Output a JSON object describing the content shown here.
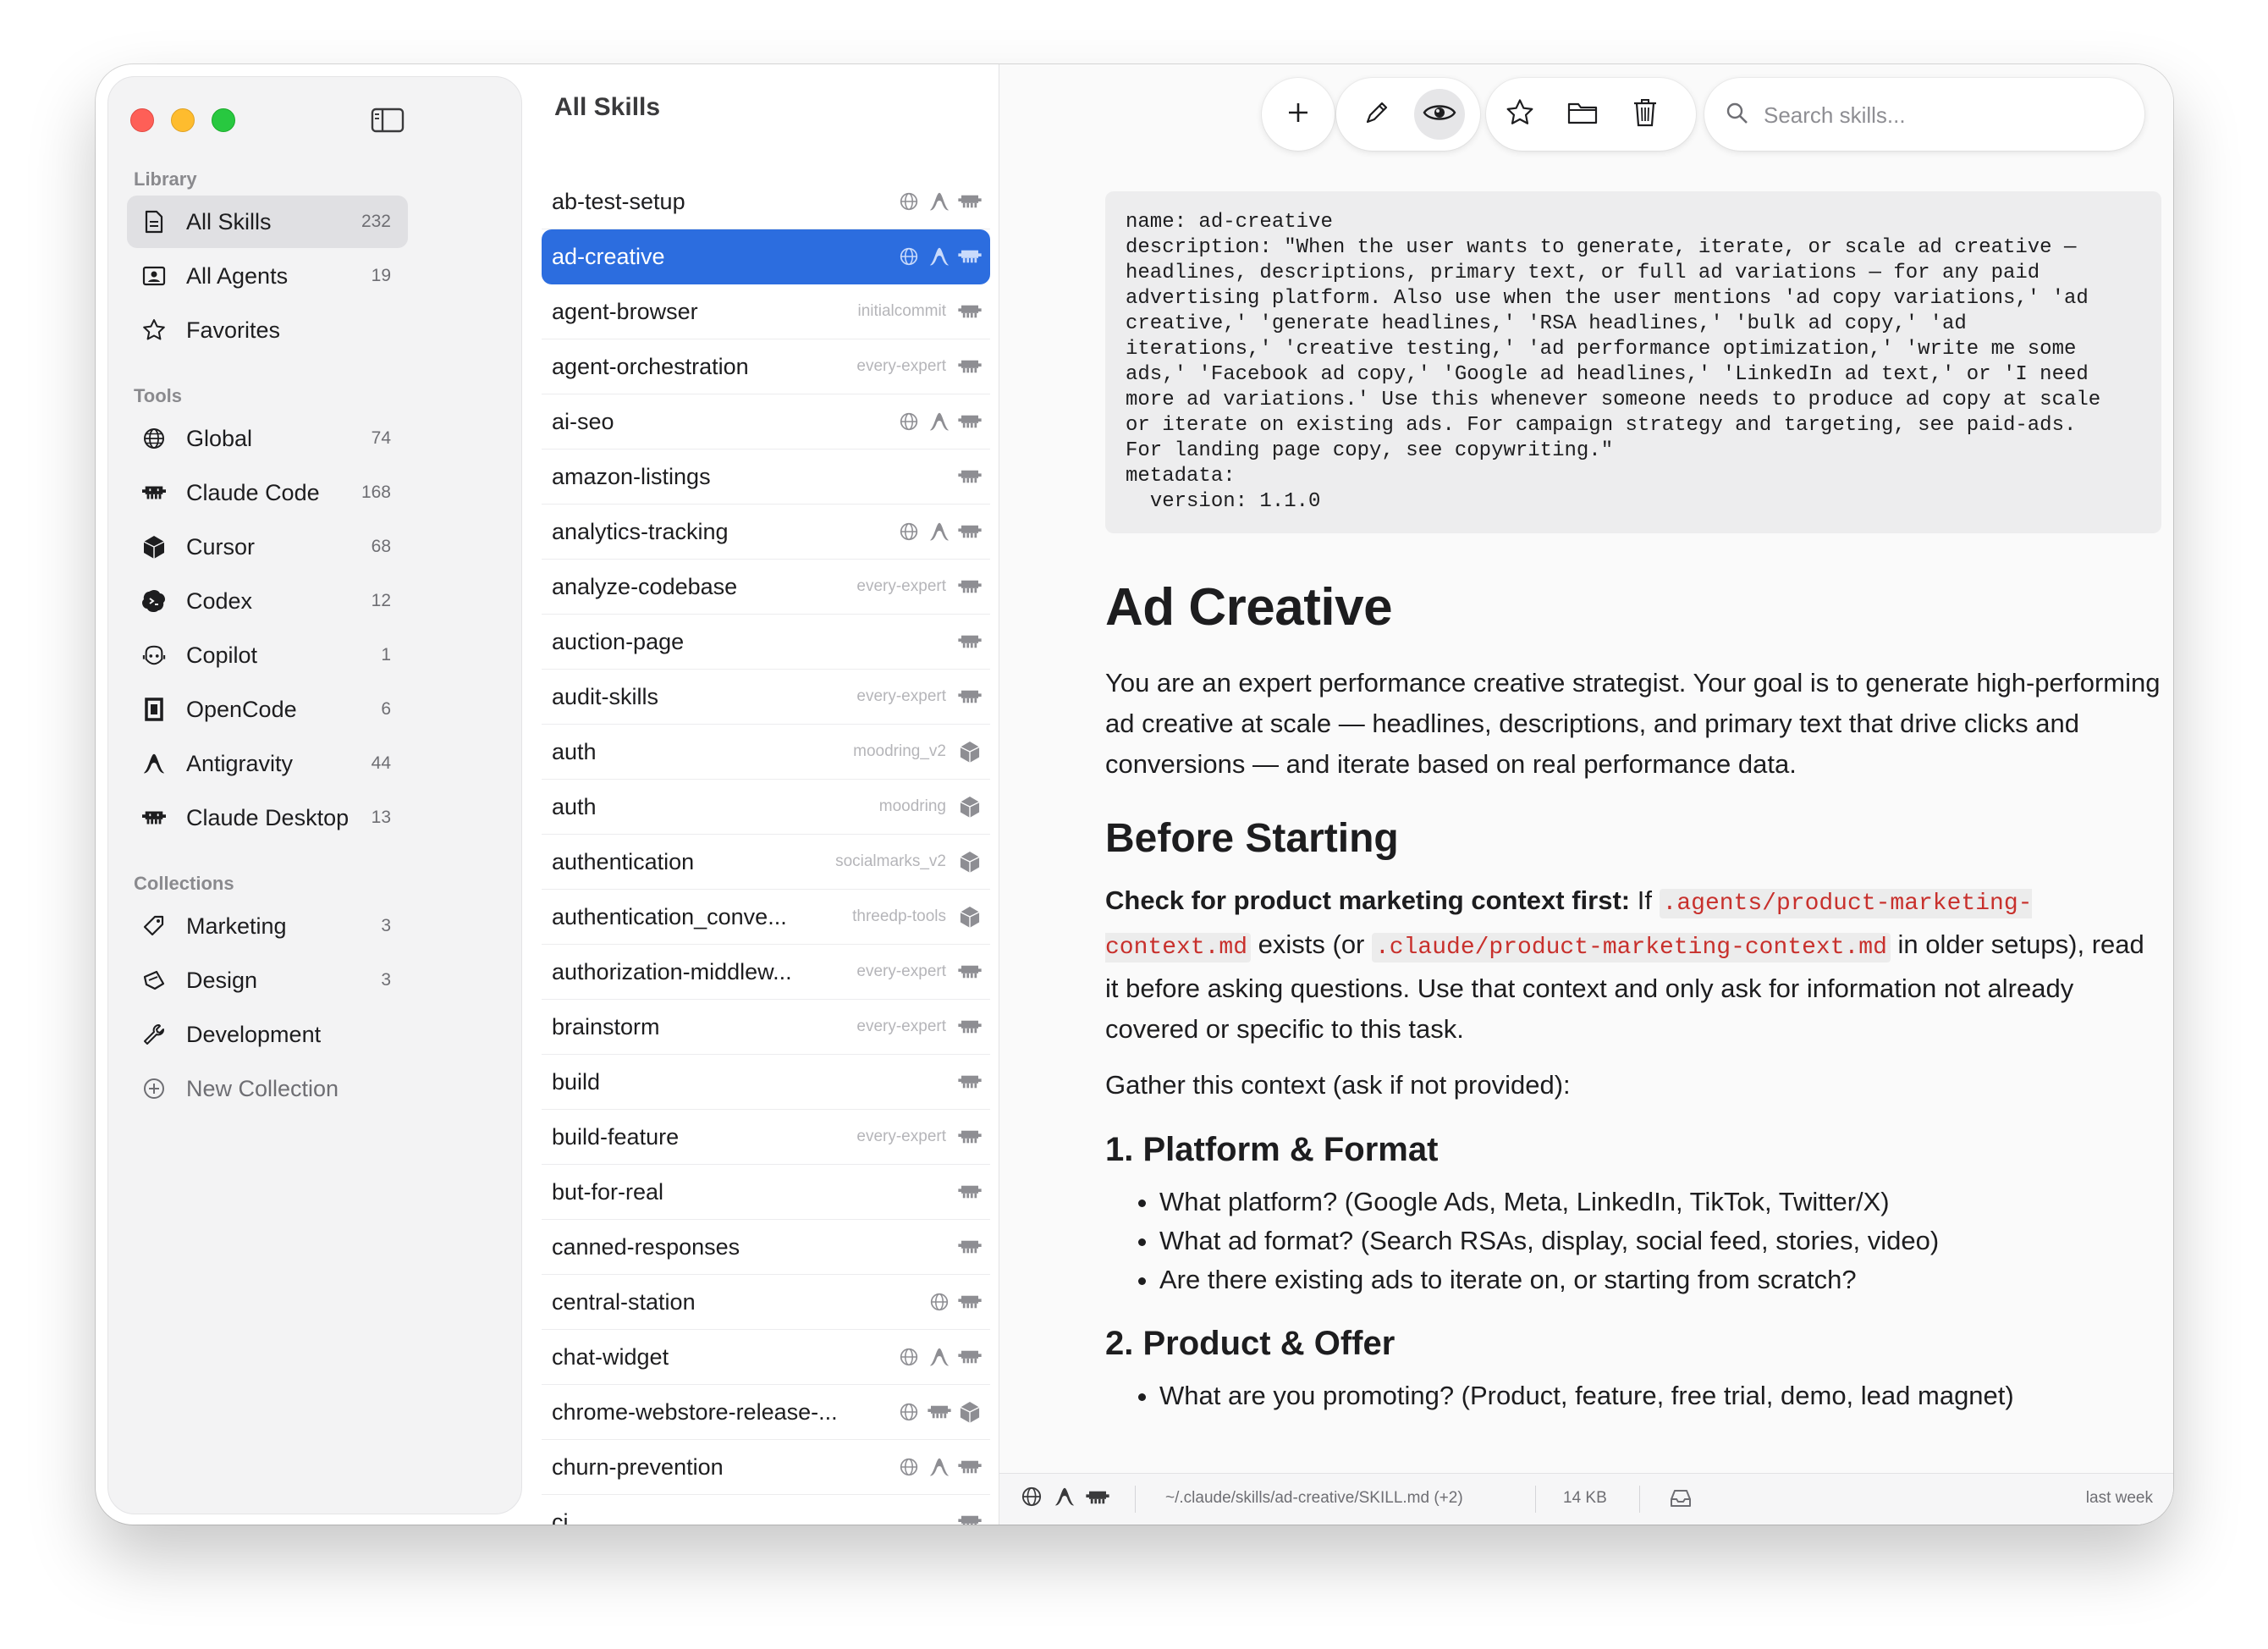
{
  "sidebar": {
    "library_title": "Library",
    "tools_title": "Tools",
    "collections_title": "Collections",
    "library": [
      {
        "label": "All Skills",
        "count": "232",
        "icon": "document-icon"
      },
      {
        "label": "All Agents",
        "count": "19",
        "icon": "person-card-icon"
      },
      {
        "label": "Favorites",
        "count": "",
        "icon": "star-icon"
      }
    ],
    "tools": [
      {
        "label": "Global",
        "count": "74",
        "icon": "globe-icon"
      },
      {
        "label": "Claude Code",
        "count": "168",
        "icon": "claude-code-icon"
      },
      {
        "label": "Cursor",
        "count": "68",
        "icon": "cursor-cube-icon"
      },
      {
        "label": "Codex",
        "count": "12",
        "icon": "codex-icon"
      },
      {
        "label": "Copilot",
        "count": "1",
        "icon": "copilot-icon"
      },
      {
        "label": "OpenCode",
        "count": "6",
        "icon": "opencode-icon"
      },
      {
        "label": "Antigravity",
        "count": "44",
        "icon": "antigravity-icon"
      },
      {
        "label": "Claude Desktop",
        "count": "13",
        "icon": "claude-desktop-icon"
      }
    ],
    "collections": [
      {
        "label": "Marketing",
        "count": "3",
        "icon": "tag-icon"
      },
      {
        "label": "Design",
        "count": "3",
        "icon": "palette-icon"
      },
      {
        "label": "Development",
        "count": "",
        "icon": "wrench-icon"
      }
    ],
    "new_collection": "New Collection"
  },
  "list": {
    "title": "All Skills",
    "rows": [
      {
        "name": "ab-test-setup",
        "org": "",
        "tags": [
          "globe",
          "antigravity",
          "claude"
        ]
      },
      {
        "name": "ad-creative",
        "org": "",
        "tags": [
          "globe",
          "antigravity",
          "claude"
        ],
        "selected": true
      },
      {
        "name": "agent-browser",
        "org": "initialcommit",
        "tags": [
          "claude"
        ]
      },
      {
        "name": "agent-orchestration",
        "org": "every-expert",
        "tags": [
          "claude"
        ]
      },
      {
        "name": "ai-seo",
        "org": "",
        "tags": [
          "globe",
          "antigravity",
          "claude"
        ]
      },
      {
        "name": "amazon-listings",
        "org": "",
        "tags": [
          "claude"
        ]
      },
      {
        "name": "analytics-tracking",
        "org": "",
        "tags": [
          "globe",
          "antigravity",
          "claude"
        ]
      },
      {
        "name": "analyze-codebase",
        "org": "every-expert",
        "tags": [
          "claude"
        ]
      },
      {
        "name": "auction-page",
        "org": "",
        "tags": [
          "claude"
        ]
      },
      {
        "name": "audit-skills",
        "org": "every-expert",
        "tags": [
          "claude"
        ]
      },
      {
        "name": "auth",
        "org": "moodring_v2",
        "tags": [
          "cursor"
        ]
      },
      {
        "name": "auth",
        "org": "moodring",
        "tags": [
          "cursor"
        ]
      },
      {
        "name": "authentication",
        "org": "socialmarks_v2",
        "tags": [
          "cursor"
        ]
      },
      {
        "name": "authentication_conve...",
        "org": "threedp-tools",
        "tags": [
          "cursor"
        ]
      },
      {
        "name": "authorization-middlew...",
        "org": "every-expert",
        "tags": [
          "claude"
        ]
      },
      {
        "name": "brainstorm",
        "org": "every-expert",
        "tags": [
          "claude"
        ]
      },
      {
        "name": "build",
        "org": "",
        "tags": [
          "claude"
        ]
      },
      {
        "name": "build-feature",
        "org": "every-expert",
        "tags": [
          "claude"
        ]
      },
      {
        "name": "but-for-real",
        "org": "",
        "tags": [
          "claude"
        ]
      },
      {
        "name": "canned-responses",
        "org": "",
        "tags": [
          "claude"
        ]
      },
      {
        "name": "central-station",
        "org": "",
        "tags": [
          "globe",
          "claude"
        ]
      },
      {
        "name": "chat-widget",
        "org": "",
        "tags": [
          "globe",
          "antigravity",
          "claude"
        ]
      },
      {
        "name": "chrome-webstore-release-...",
        "org": "",
        "tags": [
          "globe",
          "claude",
          "cursor"
        ]
      },
      {
        "name": "churn-prevention",
        "org": "",
        "tags": [
          "globe",
          "antigravity",
          "claude"
        ]
      },
      {
        "name": "ci",
        "org": "",
        "tags": [
          "claude"
        ]
      }
    ]
  },
  "toolbar": {
    "add": "add-icon",
    "edit": "pencil-icon",
    "preview": "eye-icon",
    "favorite": "star-icon",
    "folder": "folder-icon",
    "delete": "trash-icon"
  },
  "search": {
    "placeholder": "Search skills...",
    "value": ""
  },
  "doc": {
    "frontmatter": "name: ad-creative\ndescription: \"When the user wants to generate, iterate, or scale ad creative —\nheadlines, descriptions, primary text, or full ad variations — for any paid\nadvertising platform. Also use when the user mentions 'ad copy variations,' 'ad\ncreative,' 'generate headlines,' 'RSA headlines,' 'bulk ad copy,' 'ad\niterations,' 'creative testing,' 'ad performance optimization,' 'write me some\nads,' 'Facebook ad copy,' 'Google ad headlines,' 'LinkedIn ad text,' or 'I need\nmore ad variations.' Use this whenever someone needs to produce ad copy at scale\nor iterate on existing ads. For campaign strategy and targeting, see paid-ads.\nFor landing page copy, see copywriting.\"\nmetadata:\n  version: 1.1.0",
    "h1": "Ad Creative",
    "intro": "You are an expert performance creative strategist. Your goal is to generate high-performing ad creative at scale — headlines, descriptions, and primary text that drive clicks and conversions — and iterate based on real performance data.",
    "h2_before": "Before Starting",
    "check_bold": "Check for product marketing context first:",
    "check_if": " If ",
    "code1": ".agents/product-marketing-context.md",
    "check_mid": " exists (or ",
    "code2": ".claude/product-marketing-context.md",
    "check_rest": " in older setups), read it before asking questions. Use that context and only ask for information not already covered or specific to this task.",
    "gather": "Gather this context (ask if not provided):",
    "h3_platform": "1. Platform & Format",
    "platform_items": [
      "What platform? (Google Ads, Meta, LinkedIn, TikTok, Twitter/X)",
      "What ad format? (Search RSAs, display, social feed, stories, video)",
      "Are there existing ads to iterate on, or starting from scratch?"
    ],
    "h3_product": "2. Product & Offer",
    "product_items": [
      "What are you promoting? (Product, feature, free trial, demo, lead magnet)"
    ]
  },
  "status": {
    "path": "~/.claude/skills/ad-creative/SKILL.md (+2)",
    "size": "14 KB",
    "modified": "last week"
  },
  "colors": {
    "accent": "#2c6ddf",
    "code_text": "#c8302c",
    "close": "#fe5f57",
    "minimize": "#febc2e",
    "zoom": "#28c840"
  }
}
